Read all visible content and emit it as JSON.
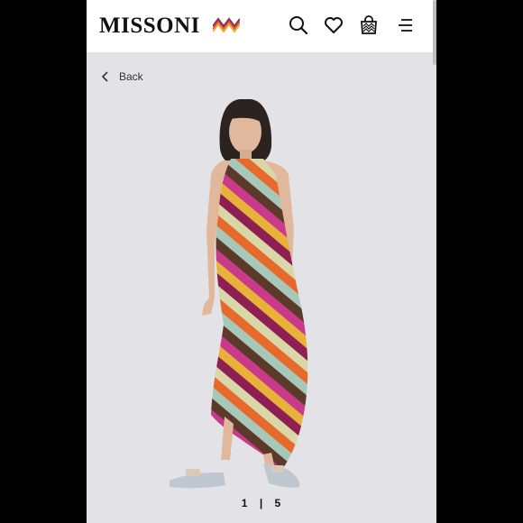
{
  "brand": {
    "name": "MISSONI"
  },
  "header": {
    "icons": [
      "search-icon",
      "heart-icon",
      "shopping-bag-icon",
      "menu-icon"
    ]
  },
  "nav": {
    "back_label": "Back"
  },
  "gallery": {
    "current": "1",
    "separator": "|",
    "total": "5"
  },
  "colors": {
    "background": "#e3e3e7",
    "header": "#ffffff",
    "stripes": [
      "#8e1f52",
      "#d9d7a8",
      "#e56a2c",
      "#a7c7b9",
      "#5b3a2a",
      "#c93b8a",
      "#e8b23a"
    ]
  }
}
